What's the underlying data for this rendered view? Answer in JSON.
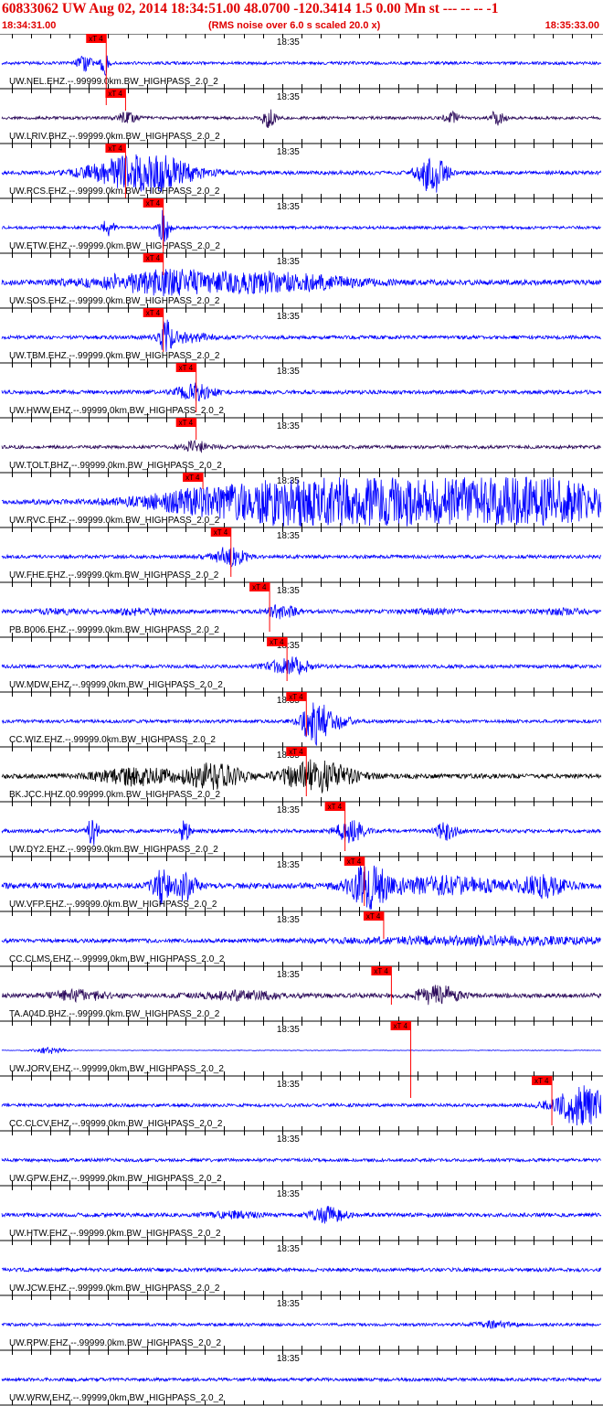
{
  "header": {
    "title": "60833062 UW Aug 02, 2014 18:34:51.00   48.0700 -120.3414  1.5 0.00 Mn st --- -- --  -1",
    "start_time": "18:34:31.00",
    "noise_note": "(RMS noise over 6.0 s scaled 20.0 x)",
    "end_time": "18:35:33.00"
  },
  "colors": {
    "header_text": "#e00000",
    "trace_blue": "#0000ff",
    "trace_purple": "#2b0a5a",
    "trace_black": "#000000",
    "pick_red": "#ff0000"
  },
  "chart_data": {
    "type": "line",
    "title": "60833062 UW Aug 02, 2014 18:34:51.00",
    "x_range": [
      "18:34:31.00",
      "18:35:33.00"
    ],
    "x_range_seconds": [
      0,
      62
    ],
    "center_tick_label": "18:35",
    "center_tick_seconds": 29,
    "pick_label": "xT 4",
    "traces": [
      {
        "label": "UW.NEL.EHZ.--.99999.0km.BW_HIGHPASS_2.0_2",
        "pick_s": 10.8,
        "color": "blue",
        "amp": 1,
        "events": [
          [
            8.5,
            8,
            1.2
          ],
          [
            10.6,
            14,
            0.6
          ]
        ],
        "pick_extend": 1.3
      },
      {
        "label": "UW.LRIV.BHZ.--.99999.0km.BW_HIGHPASS_2.0_2",
        "pick_s": 12.8,
        "color": "purple",
        "amp": 1,
        "events": [
          [
            12.9,
            5,
            1.5
          ],
          [
            27.6,
            10,
            1.0
          ],
          [
            46.5,
            6,
            1.2
          ],
          [
            51.2,
            7,
            1.2
          ]
        ],
        "pick_extend": 0.4
      },
      {
        "label": "UW.RCS.EHZ.--.99999.0km.BW_HIGHPASS_2.0_2",
        "pick_s": 12.8,
        "color": "blue",
        "amp": 1.3,
        "events": [
          [
            14.5,
            22,
            7
          ],
          [
            44.5,
            22,
            2.0
          ]
        ],
        "pick_extend": 1.0
      },
      {
        "label": "UW.ETW.EHZ.--.99999.0km.BW_HIGHPASS_2.0_2",
        "pick_s": 16.7,
        "color": "blue",
        "amp": 1,
        "events": [
          [
            11,
            10,
            0.8
          ],
          [
            16.8,
            20,
            0.8
          ]
        ],
        "pick_extend": 1.0
      },
      {
        "label": "UW.SOS.EHZ.--.99999.0km.BW_HIGHPASS_2.0_2",
        "pick_s": 16.7,
        "color": "blue",
        "amp": 1.8,
        "events": [
          [
            17,
            12,
            10
          ],
          [
            29,
            9,
            10
          ]
        ],
        "pick_extend": 0.4
      },
      {
        "label": "UW.TBM.EHZ.--.99999.0km.BW_HIGHPASS_2.0_2",
        "pick_s": 16.7,
        "color": "blue",
        "amp": 1.2,
        "events": [
          [
            17,
            18,
            0.8
          ],
          [
            19,
            5,
            4
          ]
        ],
        "pick_extend": 0.8
      },
      {
        "label": "UW.HWW.EHZ.--.99999.0km.BW_HIGHPASS_2.0_2",
        "pick_s": 20.1,
        "color": "blue",
        "amp": 1.3,
        "events": [
          [
            20,
            9,
            2.5
          ]
        ],
        "pick_extend": 0.9
      },
      {
        "label": "UW.TOLT.BHZ.--.99999.0km.BW_HIGHPASS_2.0_2",
        "pick_s": 20.1,
        "color": "purple",
        "amp": 1.1,
        "events": [
          [
            20.1,
            6,
            2.0
          ]
        ],
        "pick_extend": 0.4
      },
      {
        "label": "UW.RVC.EHZ.--.99999.0km.BW_HIGHPASS_2.0_2",
        "pick_s": 20.8,
        "color": "blue",
        "amp": 1.5,
        "events": [
          [
            20,
            6,
            8
          ],
          [
            43,
            50,
            24
          ]
        ],
        "pick_extend": 0.3
      },
      {
        "label": "UW.FHE.EHZ.--.99999.0km.BW_HIGHPASS_2.0_2",
        "pick_s": 23.7,
        "color": "blue",
        "amp": 1.2,
        "events": [
          [
            23.5,
            10,
            2.5
          ]
        ],
        "pick_extend": 0.9
      },
      {
        "label": "PB.B006.EHZ.--.99999.0km.BW_HIGHPASS_2.0_2",
        "pick_s": 27.7,
        "color": "blue",
        "amp": 1.3,
        "events": [
          [
            6,
            2,
            4
          ],
          [
            14,
            3,
            4
          ],
          [
            29,
            7,
            2
          ],
          [
            44.5,
            2,
            4
          ],
          [
            58,
            2,
            5
          ]
        ],
        "pick_extend": 0.9
      },
      {
        "label": "UW.MDW.EHZ.--.99999.0km.BW_HIGHPASS_2.0_2",
        "pick_s": 29.5,
        "color": "blue",
        "amp": 1.2,
        "events": [
          [
            29.8,
            9,
            3
          ]
        ],
        "pick_extend": 0.8
      },
      {
        "label": "CC.WIZ.EHZ.--.99999.0km.BW_HIGHPASS_2.0_2",
        "pick_s": 31.5,
        "color": "blue",
        "amp": 1.1,
        "events": [
          [
            32.2,
            22,
            1.5
          ],
          [
            33.5,
            12,
            3
          ]
        ],
        "pick_extend": 0.8
      },
      {
        "label": "BK.JCC.HHZ.00.99999.0km.BW_HIGHPASS_2.0_2",
        "pick_s": 31.5,
        "color": "black",
        "amp": 1.6,
        "events": [
          [
            14,
            9,
            6
          ],
          [
            22,
            13,
            4
          ],
          [
            32.6,
            17,
            5
          ]
        ],
        "pick_extend": 0.9
      },
      {
        "label": "UW.DY2.EHZ.--.99999.0km.BW_HIGHPASS_2.0_2",
        "pick_s": 35.5,
        "color": "blue",
        "amp": 1.2,
        "events": [
          [
            9.4,
            16,
            0.8
          ],
          [
            18.9,
            12,
            0.8
          ],
          [
            36,
            13,
            2
          ],
          [
            46,
            10,
            1.5
          ]
        ],
        "pick_extend": 0.9
      },
      {
        "label": "UW.VFP.EHZ.--.99999.0km.BW_HIGHPASS_2.0_2",
        "pick_s": 37.5,
        "color": "blue",
        "amp": 2,
        "events": [
          [
            16.5,
            20,
            1.2
          ],
          [
            19,
            16,
            1.5
          ],
          [
            38,
            22,
            3
          ],
          [
            46,
            9,
            8
          ],
          [
            56,
            12,
            3
          ]
        ],
        "pick_extend": 0.9
      },
      {
        "label": "CC.CLMS.EHZ.--.99999.0km.BW_HIGHPASS_2.0_2",
        "pick_s": 39.5,
        "color": "blue",
        "amp": 1.3,
        "events": [
          [
            50,
            4,
            20
          ]
        ],
        "pick_extend": 0.5
      },
      {
        "label": "TA.A04D.BHZ.--.99999.0km.BW_HIGHPASS_2.0_2",
        "pick_s": 40.3,
        "color": "purple",
        "amp": 1.5,
        "events": [
          [
            8,
            5,
            4
          ],
          [
            45,
            11,
            3
          ],
          [
            25,
            4,
            6
          ]
        ],
        "pick_extend": 0.7
      },
      {
        "label": "UW.JORV.EHZ.--.99999.0km.BW_HIGHPASS_2.0_2",
        "pick_s": 42.3,
        "color": "blue",
        "amp": 0.2,
        "events": [
          [
            5,
            4,
            2
          ]
        ],
        "pick_extend": 1.4
      },
      {
        "label": "CC.CLCV.EHZ.--.99999.0km.BW_HIGHPASS_2.0_2",
        "pick_s": 56.9,
        "color": "blue",
        "amp": 1.1,
        "events": [
          [
            60,
            22,
            4
          ]
        ],
        "pick_extend": 0.9
      },
      {
        "label": "UW.GPW.EHZ.--.99999.0km.BW_HIGHPASS_2.0_2",
        "pick_s": null,
        "color": "blue",
        "amp": 1.1,
        "events": [],
        "pick_extend": 0
      },
      {
        "label": "UW.HTW.EHZ.--.99999.0km.BW_HIGHPASS_2.0_2",
        "pick_s": null,
        "color": "blue",
        "amp": 1.3,
        "events": [
          [
            33.8,
            8,
            2.5
          ],
          [
            24,
            3,
            4
          ]
        ],
        "pick_extend": 0
      },
      {
        "label": "UW.JCW.EHZ.--.99999.0km.BW_HIGHPASS_2.0_2",
        "pick_s": null,
        "color": "blue",
        "amp": 1.2,
        "events": [],
        "pick_extend": 0
      },
      {
        "label": "UW.RPW.EHZ.--.99999.0km.BW_HIGHPASS_2.0_2",
        "pick_s": null,
        "color": "blue",
        "amp": 1.0,
        "events": [
          [
            51,
            3,
            3
          ]
        ],
        "pick_extend": 0
      },
      {
        "label": "UW.WRW.EHZ.--.99999.0km.BW_HIGHPASS_2.0_2",
        "pick_s": null,
        "color": "blue",
        "amp": 1.1,
        "events": [],
        "pick_extend": 0
      }
    ]
  }
}
